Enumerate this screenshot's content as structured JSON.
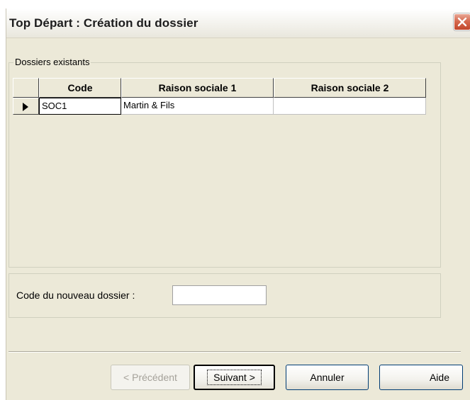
{
  "window": {
    "title": "Top Départ : Création du dossier"
  },
  "existing": {
    "legend": "Dossiers existants",
    "columns": [
      "Code",
      "Raison sociale 1",
      "Raison sociale 2"
    ],
    "rows": [
      {
        "code": "SOC1",
        "raison1": "Martin & Fils",
        "raison2": ""
      }
    ]
  },
  "new_file": {
    "label": "Code du nouveau dossier :",
    "value": ""
  },
  "buttons": {
    "previous": "< Précédent",
    "next": "Suivant >",
    "cancel": "Annuler",
    "help": "Aide"
  },
  "icons": {
    "close": "close-icon",
    "row_pointer": "row-pointer-icon"
  }
}
